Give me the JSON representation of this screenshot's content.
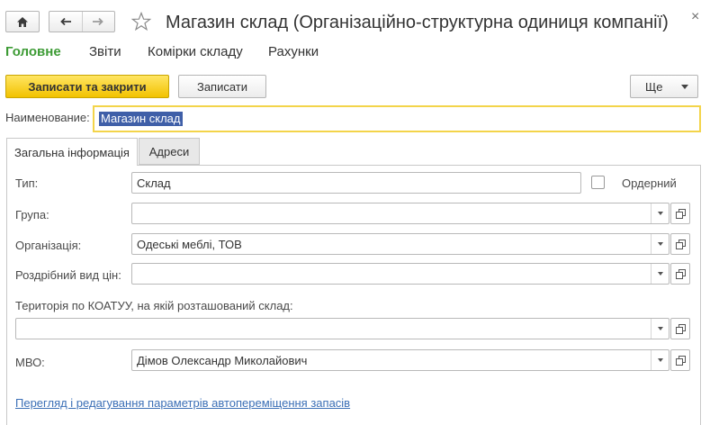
{
  "window": {
    "title": "Магазин склад (Організаційно-структурна одиниця компанії)",
    "home_icon": "home-icon",
    "back_icon": "arrow-left-icon",
    "forward_icon": "arrow-right-icon",
    "favorite_icon": "star-icon",
    "close_label": "×"
  },
  "menu": {
    "items": [
      "Головне",
      "Звіти",
      "Комірки складу",
      "Рахунки"
    ],
    "active_color": "#3d9b35"
  },
  "toolbar": {
    "save_close_label": "Записати та закрити",
    "save_label": "Записати",
    "more_label": "Ще",
    "primary_color": "#f2c200"
  },
  "name": {
    "label": "Наименование:",
    "value": "Магазин склад"
  },
  "tabs": [
    "Загальна інформація",
    "Адреси"
  ],
  "form": {
    "type_label": "Тип:",
    "type_value": "Склад",
    "ordered_label": "Ордерний",
    "ordered_checked": false,
    "group_label": "Група:",
    "group_value": "",
    "org_label": "Організація:",
    "org_value": "Одеські меблі, ТОВ",
    "price_label": "Роздрібний вид цін:",
    "price_value": "",
    "territory_label": "Територія по КОАТУУ, на якій розташований склад:",
    "territory_value": "",
    "mvo_label": "МВО:",
    "mvo_value": "Дімов Олександр Миколайович"
  },
  "link": {
    "label": "Перегляд і редагування параметрів автопереміщення запасів"
  }
}
